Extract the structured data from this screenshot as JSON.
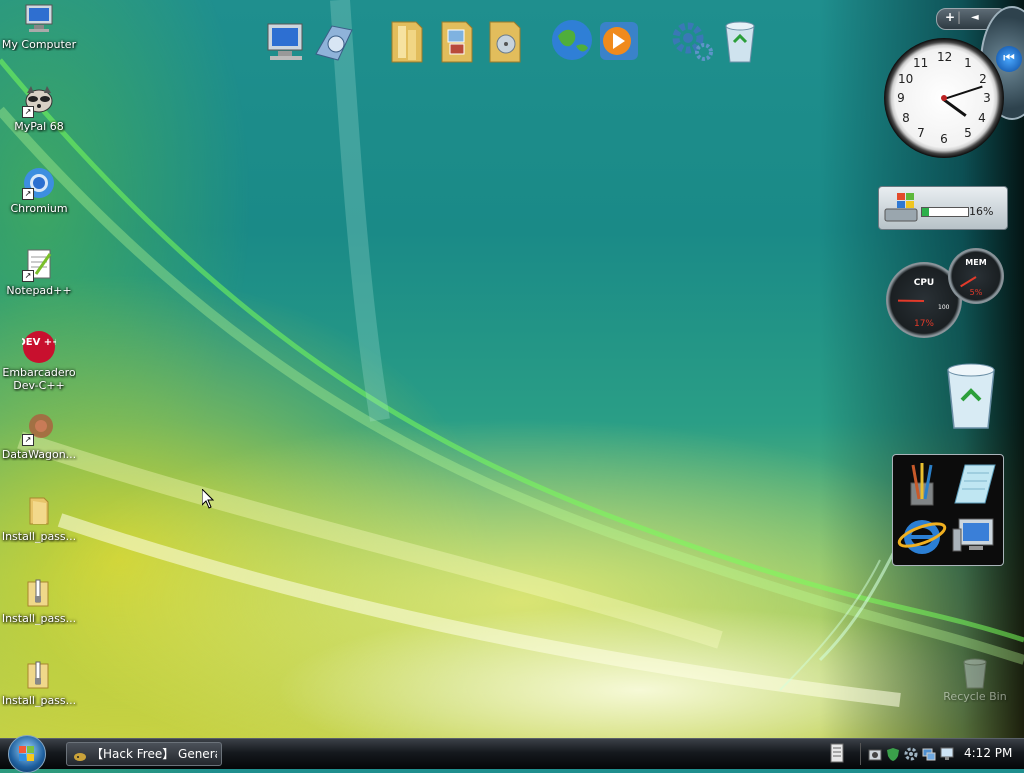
{
  "desktop": {
    "icons": [
      {
        "label": "My Computer",
        "icon": "computer-icon"
      },
      {
        "label": "MyPal 68",
        "icon": "raccoon-browser-icon"
      },
      {
        "label": "Chromium",
        "icon": "chromium-icon"
      },
      {
        "label": "Notepad++",
        "icon": "notepad-plus-plus-icon"
      },
      {
        "label": "Embarcadero Dev-C++",
        "icon": "dev-cpp-icon",
        "glyph_text": "DEV ++"
      },
      {
        "label": "DataWagon...",
        "icon": "datawagon-icon"
      },
      {
        "label": "Install_pass...",
        "icon": "folder-icon"
      },
      {
        "label": "Install_pass...",
        "icon": "zip-folder-icon"
      },
      {
        "label": "Install_pass...",
        "icon": "zip-folder-icon"
      }
    ],
    "recycle_bin_label": "Recycle Bin"
  },
  "dock": {
    "icons": [
      "computer-icon",
      "network-drive-icon",
      "documents-folder-icon",
      "pictures-folder-icon",
      "music-folder-icon",
      "internet-globe-icon",
      "media-player-icon",
      "settings-gears-icon",
      "recycle-bin-icon"
    ]
  },
  "sidebar": {
    "controls": {
      "add": "+",
      "prev": "◄"
    },
    "cpu_meter": {
      "label": "CPU",
      "value_text": "17%",
      "value": 17,
      "scale_max": "100"
    },
    "mem_meter": {
      "label": "MEM",
      "value_text": "5%",
      "value": 5
    },
    "disk_meter": {
      "value_text": "16%",
      "value": 16
    },
    "clock": {
      "hour": 4,
      "minute": 12
    },
    "quick_launch": [
      "paint-brushes-icon",
      "notepad-icon",
      "internet-explorer-icon",
      "computer-icon"
    ]
  },
  "taskbar": {
    "task_button_label": "【Hack Free】 Generat...",
    "tray_icons": [
      "keyboard-icon",
      "camera-icon",
      "shield-icon",
      "settings-icon",
      "network-icon",
      "display-icon"
    ],
    "time": "4:12 PM"
  },
  "colors": {
    "accent": "#1f8f8e",
    "taskbar": "#15191e"
  }
}
